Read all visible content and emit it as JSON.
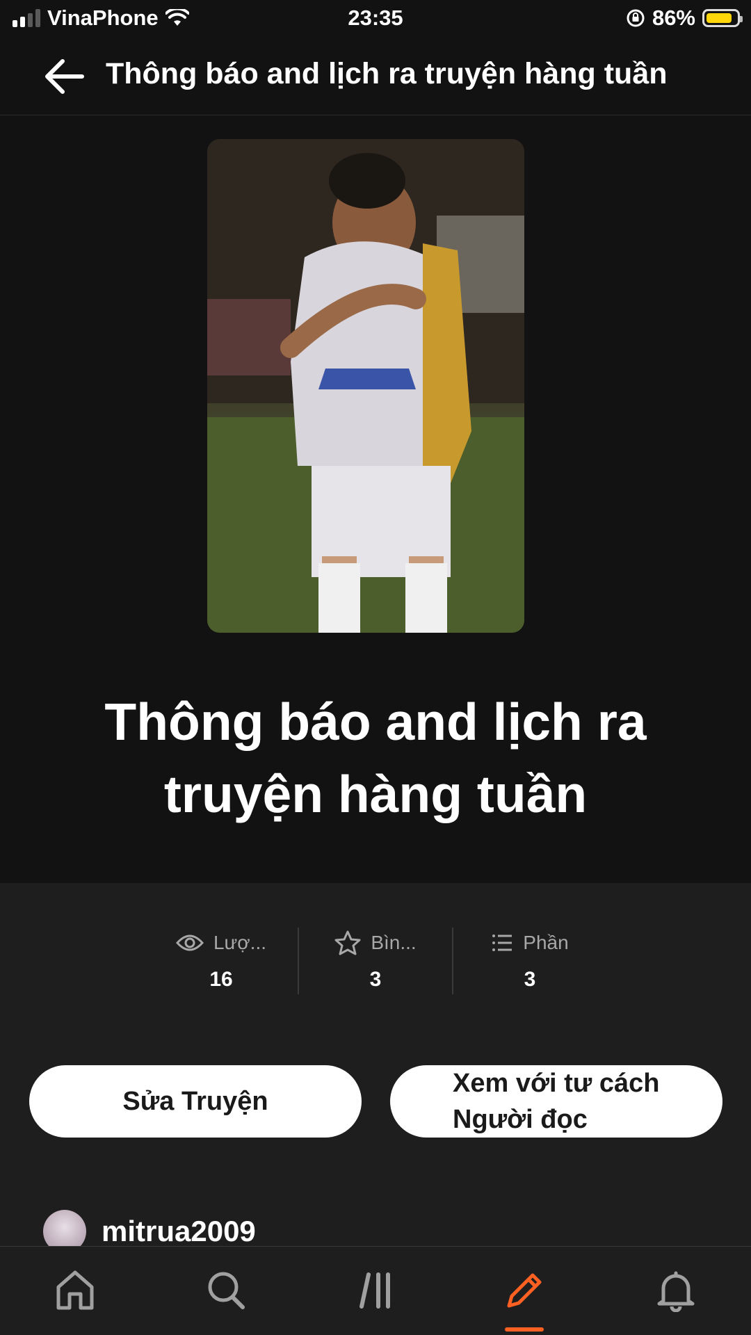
{
  "status_bar": {
    "carrier": "VinaPhone",
    "time": "23:35",
    "battery_percent": "86%",
    "battery_level": 0.86
  },
  "header": {
    "title": "Thông báo and lịch ra truyện hàng tuần"
  },
  "story": {
    "title_line1": "Thông báo and lịch ra",
    "title_line2": "truyện hàng tuần"
  },
  "stats": [
    {
      "icon": "eye-icon",
      "label": "Lượ...",
      "value": "16"
    },
    {
      "icon": "star-icon",
      "label": "Bìn...",
      "value": "3"
    },
    {
      "icon": "list-icon",
      "label": "Phần",
      "value": "3"
    }
  ],
  "actions": {
    "edit_label": "Sửa Truyện",
    "view_as_reader_line1": "Xem với tư cách",
    "view_as_reader_line2": "Người đọc"
  },
  "author": {
    "username": "mitrua2009"
  },
  "tabs": [
    {
      "icon": "home-icon"
    },
    {
      "icon": "search-icon"
    },
    {
      "icon": "library-icon"
    },
    {
      "icon": "pencil-icon",
      "active": true
    },
    {
      "icon": "bell-icon"
    }
  ],
  "colors": {
    "accent": "#ff6122",
    "background": "#121212",
    "panel": "#1e1e1e",
    "battery": "#ffd60a"
  }
}
